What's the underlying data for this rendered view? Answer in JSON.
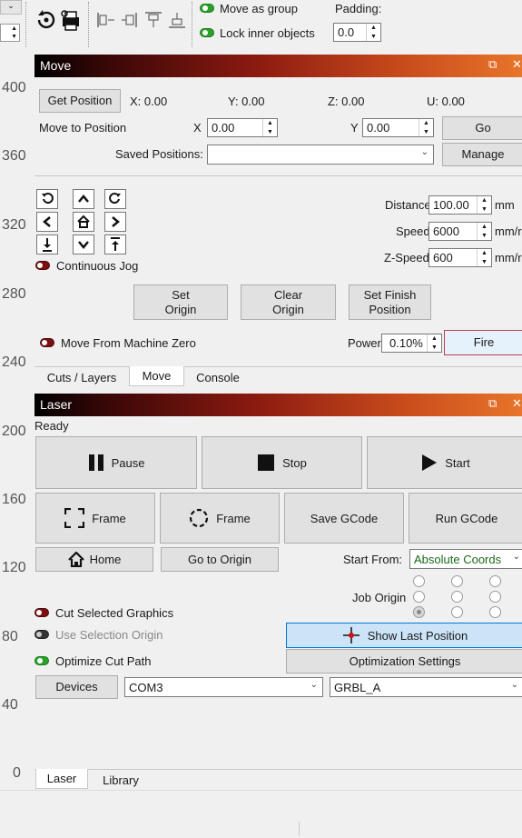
{
  "toolbar": {
    "move_as_group": "Move as group",
    "lock_inner": "Lock inner objects",
    "padding_label": "Padding:",
    "padding_value": "0.0"
  },
  "ruler": [
    "400",
    "360",
    "320",
    "280",
    "240",
    "200",
    "160",
    "120",
    "80",
    "40",
    "0"
  ],
  "move": {
    "title": "Move",
    "get_position": "Get Position",
    "x_readout": "X: 0.00",
    "y_readout": "Y: 0.00",
    "z_readout": "Z: 0.00",
    "u_readout": "U: 0.00",
    "move_to_position": "Move to Position",
    "x_label": "X",
    "x_value": "0.00",
    "y_label": "Y",
    "y_value": "0.00",
    "go": "Go",
    "saved_positions": "Saved Positions:",
    "saved_value": "",
    "manage": "Manage",
    "distance_label": "Distance",
    "distance_value": "100.00",
    "distance_unit": "mm",
    "speed_label": "Speed",
    "speed_value": "6000",
    "speed_unit": "mm/r",
    "zspeed_label": "Z-Speed",
    "zspeed_value": "600",
    "zspeed_unit": "mm/r",
    "continuous_jog": "Continuous Jog",
    "set_origin": "Set\nOrigin",
    "clear_origin": "Clear\nOrigin",
    "set_finish": "Set Finish\nPosition",
    "move_from_zero": "Move From Machine Zero",
    "power_label": "Power",
    "power_value": "0.10%",
    "fire": "Fire",
    "tabs": [
      "Cuts / Layers",
      "Move",
      "Console"
    ]
  },
  "laser": {
    "title": "Laser",
    "status": "Ready",
    "pause": "Pause",
    "stop": "Stop",
    "start": "Start",
    "frame1": "Frame",
    "frame2": "Frame",
    "save_gcode": "Save GCode",
    "run_gcode": "Run GCode",
    "home": "Home",
    "go_to_origin": "Go to Origin",
    "start_from": "Start From:",
    "start_from_value": "Absolute Coords",
    "job_origin": "Job Origin",
    "cut_selected": "Cut Selected Graphics",
    "use_selection_origin": "Use Selection Origin",
    "show_last_position": "Show Last Position",
    "optimize_cut": "Optimize Cut Path",
    "optimization_settings": "Optimization Settings",
    "devices": "Devices",
    "port": "COM3",
    "profile": "GRBL_A",
    "tabs": [
      "Laser",
      "Library"
    ]
  },
  "colors": {
    "accent_blue": "#cce4f7",
    "toggle_on": "#2aa12a",
    "toggle_red": "#7a1010"
  }
}
